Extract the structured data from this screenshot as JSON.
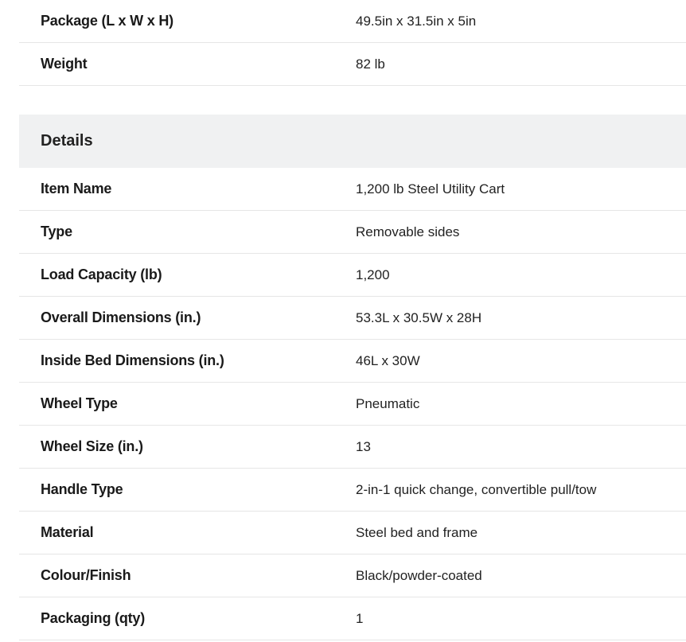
{
  "package_section": {
    "rows": [
      {
        "label": "Package (L x W x H)",
        "value": "49.5in x 31.5in x 5in"
      },
      {
        "label": "Weight",
        "value": "82 lb"
      }
    ]
  },
  "details_section": {
    "title": "Details",
    "rows": [
      {
        "label": "Item Name",
        "value": "1,200 lb Steel Utility Cart"
      },
      {
        "label": "Type",
        "value": "Removable sides"
      },
      {
        "label": "Load Capacity (lb)",
        "value": "1,200"
      },
      {
        "label": "Overall Dimensions (in.)",
        "value": "53.3L x 30.5W x 28H"
      },
      {
        "label": "Inside Bed Dimensions (in.)",
        "value": "46L x 30W"
      },
      {
        "label": "Wheel Type",
        "value": "Pneumatic"
      },
      {
        "label": "Wheel Size (in.)",
        "value": "13"
      },
      {
        "label": "Handle Type",
        "value": "2-in-1 quick change, convertible pull/tow"
      },
      {
        "label": "Material",
        "value": "Steel bed and frame"
      },
      {
        "label": "Colour/Finish",
        "value": "Black/powder-coated"
      },
      {
        "label": "Packaging (qty)",
        "value": "1"
      }
    ]
  }
}
